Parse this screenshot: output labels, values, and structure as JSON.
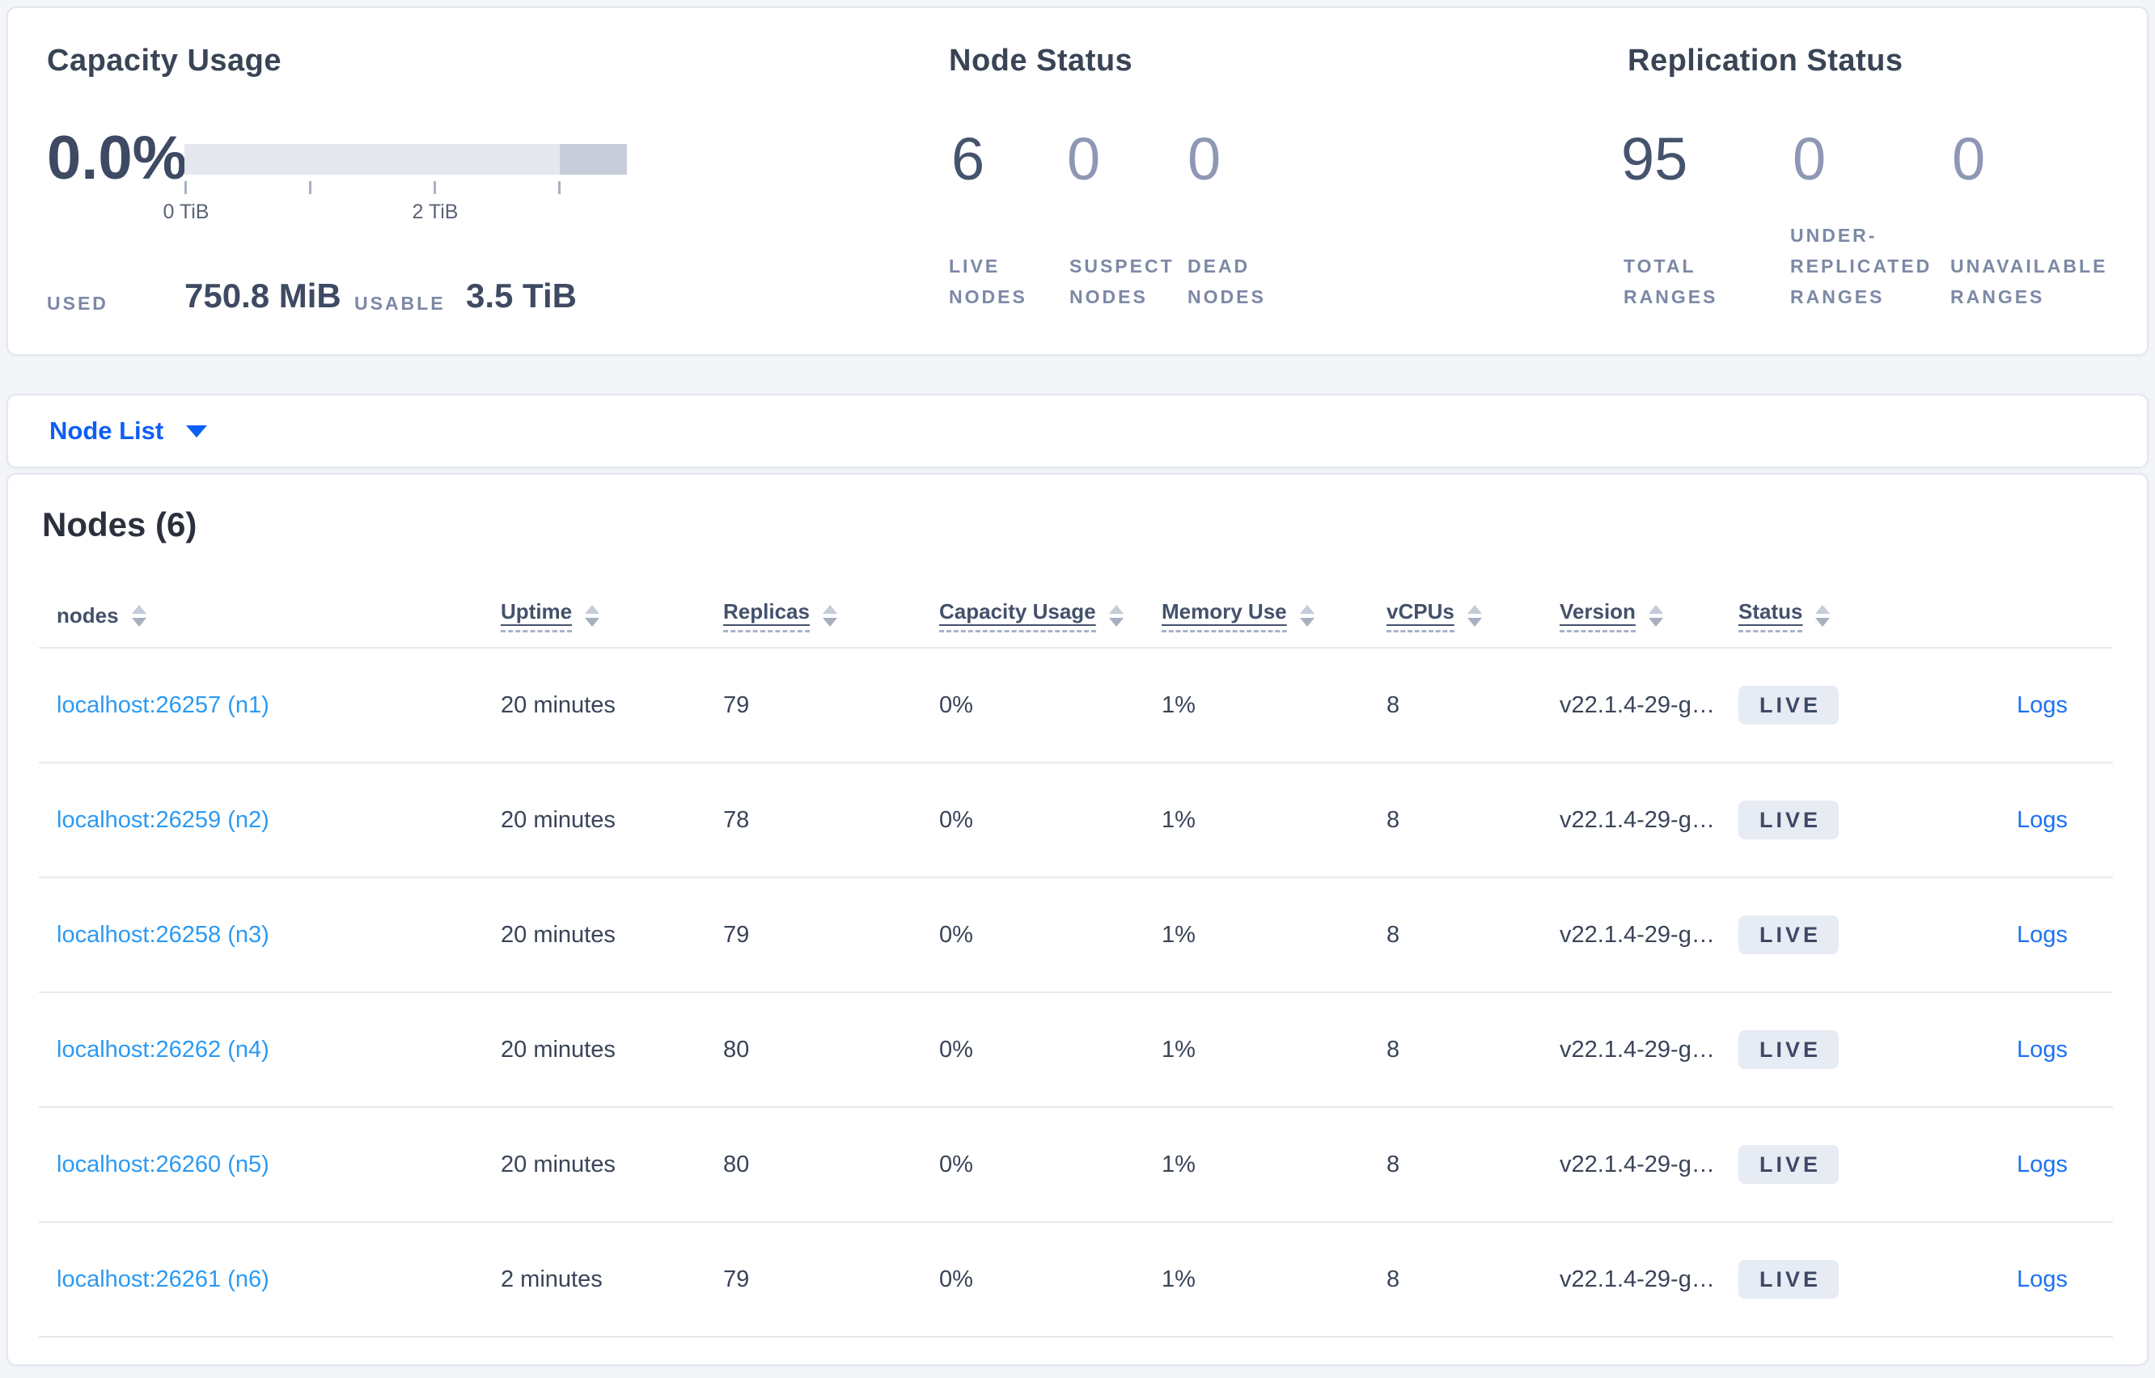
{
  "colors": {
    "page_bg": "#f3f5f9",
    "card_border": "#e3e6ee",
    "accent_blue": "#0d5ef5",
    "node_link_blue": "#2b9af3",
    "logs_link_blue": "#1c72f2",
    "badge_bg": "#e7ebf3",
    "bar_fill": "#e4e7ed",
    "bar_end_fill": "#c8cdda",
    "muted_number": "#8e98b4",
    "strong_number": "#46536d"
  },
  "summary": {
    "capacity": {
      "title": "Capacity Usage",
      "percent": "0.0%",
      "tick_label_0": "0 TiB",
      "tick_label_2": "2 TiB",
      "used_label": "USED",
      "used_value": "750.8 MiB",
      "usable_label": "USABLE",
      "usable_value": "3.5 TiB"
    },
    "node_status": {
      "title": "Node Status",
      "stats": [
        {
          "value": "6",
          "label": "LIVE NODES",
          "muted": false
        },
        {
          "value": "0",
          "label": "SUSPECT NODES",
          "muted": true
        },
        {
          "value": "0",
          "label": "DEAD NODES",
          "muted": true
        }
      ]
    },
    "replication": {
      "title": "Replication Status",
      "stats": [
        {
          "value": "95",
          "label": "TOTAL RANGES",
          "muted": false
        },
        {
          "value": "0",
          "label": "UNDER-REPLICATED RANGES",
          "muted": true
        },
        {
          "value": "0",
          "label": "UNAVAILABLE RANGES",
          "muted": true
        }
      ]
    }
  },
  "node_list_dropdown": {
    "label": "Node List"
  },
  "table": {
    "title": "Nodes (6)",
    "columns": [
      {
        "label": "nodes",
        "tooltip": false
      },
      {
        "label": "Uptime",
        "tooltip": true
      },
      {
        "label": "Replicas",
        "tooltip": true
      },
      {
        "label": "Capacity Usage",
        "tooltip": true
      },
      {
        "label": "Memory Use",
        "tooltip": true
      },
      {
        "label": "vCPUs",
        "tooltip": true
      },
      {
        "label": "Version",
        "tooltip": true
      },
      {
        "label": "Status",
        "tooltip": true
      }
    ],
    "rows": [
      {
        "node": "localhost:26257 (n1)",
        "uptime": "20 minutes",
        "replicas": "79",
        "capacity": "0%",
        "memory": "1%",
        "vcpus": "8",
        "version": "v22.1.4-29-g…",
        "status": "LIVE",
        "logs": "Logs"
      },
      {
        "node": "localhost:26259 (n2)",
        "uptime": "20 minutes",
        "replicas": "78",
        "capacity": "0%",
        "memory": "1%",
        "vcpus": "8",
        "version": "v22.1.4-29-g…",
        "status": "LIVE",
        "logs": "Logs"
      },
      {
        "node": "localhost:26258 (n3)",
        "uptime": "20 minutes",
        "replicas": "79",
        "capacity": "0%",
        "memory": "1%",
        "vcpus": "8",
        "version": "v22.1.4-29-g…",
        "status": "LIVE",
        "logs": "Logs"
      },
      {
        "node": "localhost:26262 (n4)",
        "uptime": "20 minutes",
        "replicas": "80",
        "capacity": "0%",
        "memory": "1%",
        "vcpus": "8",
        "version": "v22.1.4-29-g…",
        "status": "LIVE",
        "logs": "Logs"
      },
      {
        "node": "localhost:26260 (n5)",
        "uptime": "20 minutes",
        "replicas": "80",
        "capacity": "0%",
        "memory": "1%",
        "vcpus": "8",
        "version": "v22.1.4-29-g…",
        "status": "LIVE",
        "logs": "Logs"
      },
      {
        "node": "localhost:26261 (n6)",
        "uptime": "2 minutes",
        "replicas": "79",
        "capacity": "0%",
        "memory": "1%",
        "vcpus": "8",
        "version": "v22.1.4-29-g…",
        "status": "LIVE",
        "logs": "Logs"
      }
    ]
  }
}
